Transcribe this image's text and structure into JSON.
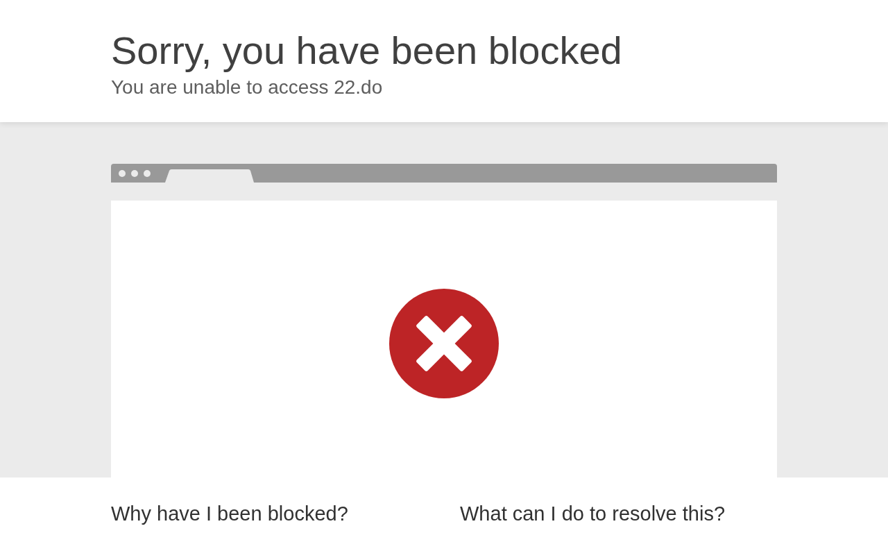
{
  "header": {
    "title": "Sorry, you have been blocked",
    "subtitle": "You are unable to access 22.do"
  },
  "sections": [
    {
      "heading": "Why have I been blocked?"
    },
    {
      "heading": "What can I do to resolve this?"
    }
  ]
}
